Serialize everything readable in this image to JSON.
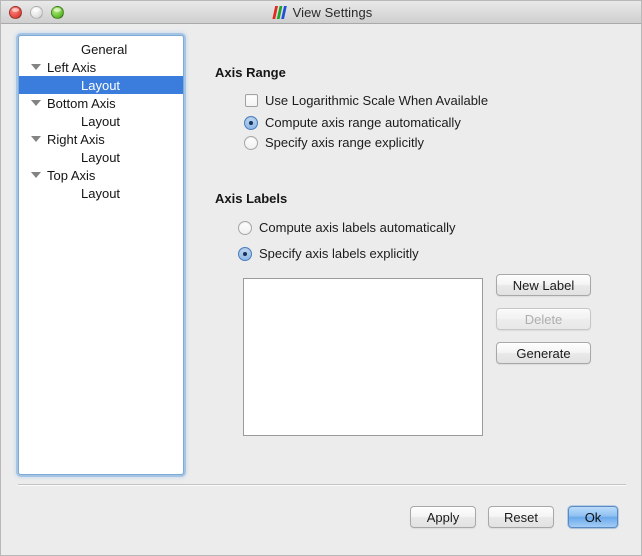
{
  "window": {
    "title": "View Settings",
    "app_icon": "bars-chart-icon",
    "background_color": "#ececec",
    "controls": [
      {
        "name": "close-button",
        "color": "#e8534a"
      },
      {
        "name": "minimize-button",
        "color": "#e6e6e6"
      },
      {
        "name": "zoom-button",
        "color": "#6fc63c"
      }
    ]
  },
  "sidebar": {
    "items": [
      {
        "label": "General",
        "indent": 1,
        "expandable": false,
        "selected": false
      },
      {
        "label": "Left Axis",
        "indent": 0,
        "expandable": true,
        "selected": false
      },
      {
        "label": "Layout",
        "indent": 1,
        "expandable": false,
        "selected": true
      },
      {
        "label": "Bottom Axis",
        "indent": 0,
        "expandable": true,
        "selected": false
      },
      {
        "label": "Layout",
        "indent": 1,
        "expandable": false,
        "selected": false
      },
      {
        "label": "Right Axis",
        "indent": 0,
        "expandable": true,
        "selected": false
      },
      {
        "label": "Layout",
        "indent": 1,
        "expandable": false,
        "selected": false
      },
      {
        "label": "Top Axis",
        "indent": 0,
        "expandable": true,
        "selected": false
      },
      {
        "label": "Layout",
        "indent": 1,
        "expandable": false,
        "selected": false
      }
    ],
    "selection_color": "#3a7ddd",
    "focus_ring_color": "#7fa9d6"
  },
  "axis_range": {
    "title": "Axis Range",
    "logarithmic_checkbox": {
      "label": "Use Logarithmic Scale When Available",
      "checked": false
    },
    "radio_group": [
      {
        "label": "Compute axis range automatically",
        "selected": true
      },
      {
        "label": "Specify axis range explicitly",
        "selected": false
      }
    ]
  },
  "axis_labels": {
    "title": "Axis Labels",
    "radio_group": [
      {
        "label": "Compute axis labels automatically",
        "selected": false
      },
      {
        "label": "Specify axis labels explicitly",
        "selected": true
      }
    ],
    "list_items": [],
    "buttons": [
      {
        "label": "New Label",
        "enabled": true
      },
      {
        "label": "Delete",
        "enabled": false
      },
      {
        "label": "Generate",
        "enabled": true
      }
    ]
  },
  "footer": {
    "buttons": [
      {
        "label": "Apply",
        "default": false
      },
      {
        "label": "Reset",
        "default": false
      },
      {
        "label": "Ok",
        "default": true
      }
    ]
  }
}
